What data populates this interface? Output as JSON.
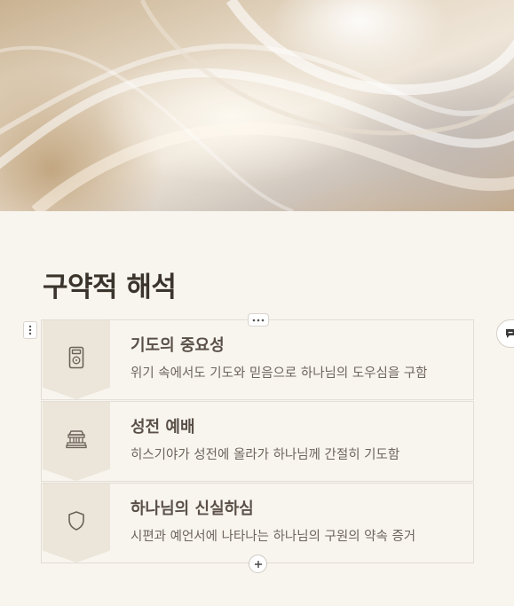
{
  "page": {
    "title": "구약적 해석"
  },
  "items": [
    {
      "icon": "device-icon",
      "title": "기도의 중요성",
      "description": "위기 속에서도 기도와 믿음으로 하나님의 도우심을 구함"
    },
    {
      "icon": "temple-icon",
      "title": "성전 예배",
      "description": "히스기야가 성전에 올라가 하나님께 간절히 기도함"
    },
    {
      "icon": "shield-icon",
      "title": "하나님의 신실하심",
      "description": "시편과 예언서에 나타나는 하나님의 구원의 약속 증거"
    }
  ],
  "colors": {
    "background": "#f8f5ef",
    "accent_chevron": "#ece5d9",
    "title_text": "#3b342c",
    "item_title": "#5a5048",
    "item_text": "#6e655c",
    "border": "#e2ddd5"
  }
}
